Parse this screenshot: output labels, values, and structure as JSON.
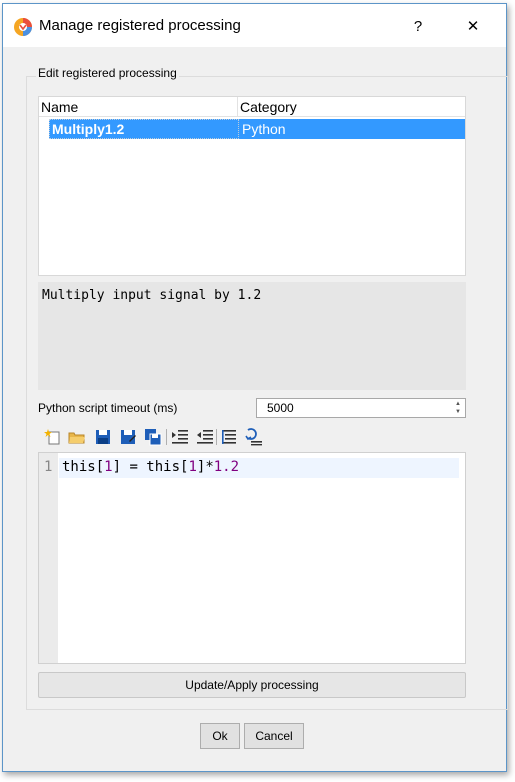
{
  "window": {
    "title": "Manage registered processing",
    "help_label": "?",
    "close_label": "✕"
  },
  "group": {
    "label": "Edit registered processing"
  },
  "table": {
    "columns": [
      "Name",
      "Category"
    ],
    "rows": [
      {
        "name": "Multiply1.2",
        "category": "Python",
        "selected": true
      }
    ]
  },
  "description": "Multiply input signal by 1.2",
  "timeout": {
    "label": "Python script timeout (ms)",
    "value": "5000"
  },
  "toolbar": {
    "icons": [
      "new-icon",
      "open-icon",
      "save-icon",
      "save-as-icon",
      "save-all-icon",
      "indent-icon",
      "unindent-icon",
      "format-icon",
      "comment-icon"
    ]
  },
  "editor": {
    "line_number": "1",
    "code_prefix": "this[",
    "code_num1": "1",
    "code_mid": "] = this[",
    "code_num2": "1",
    "code_suffix": "]*",
    "code_num3": "1.2"
  },
  "buttons": {
    "apply": "Update/Apply processing",
    "ok": "Ok",
    "cancel": "Cancel"
  }
}
